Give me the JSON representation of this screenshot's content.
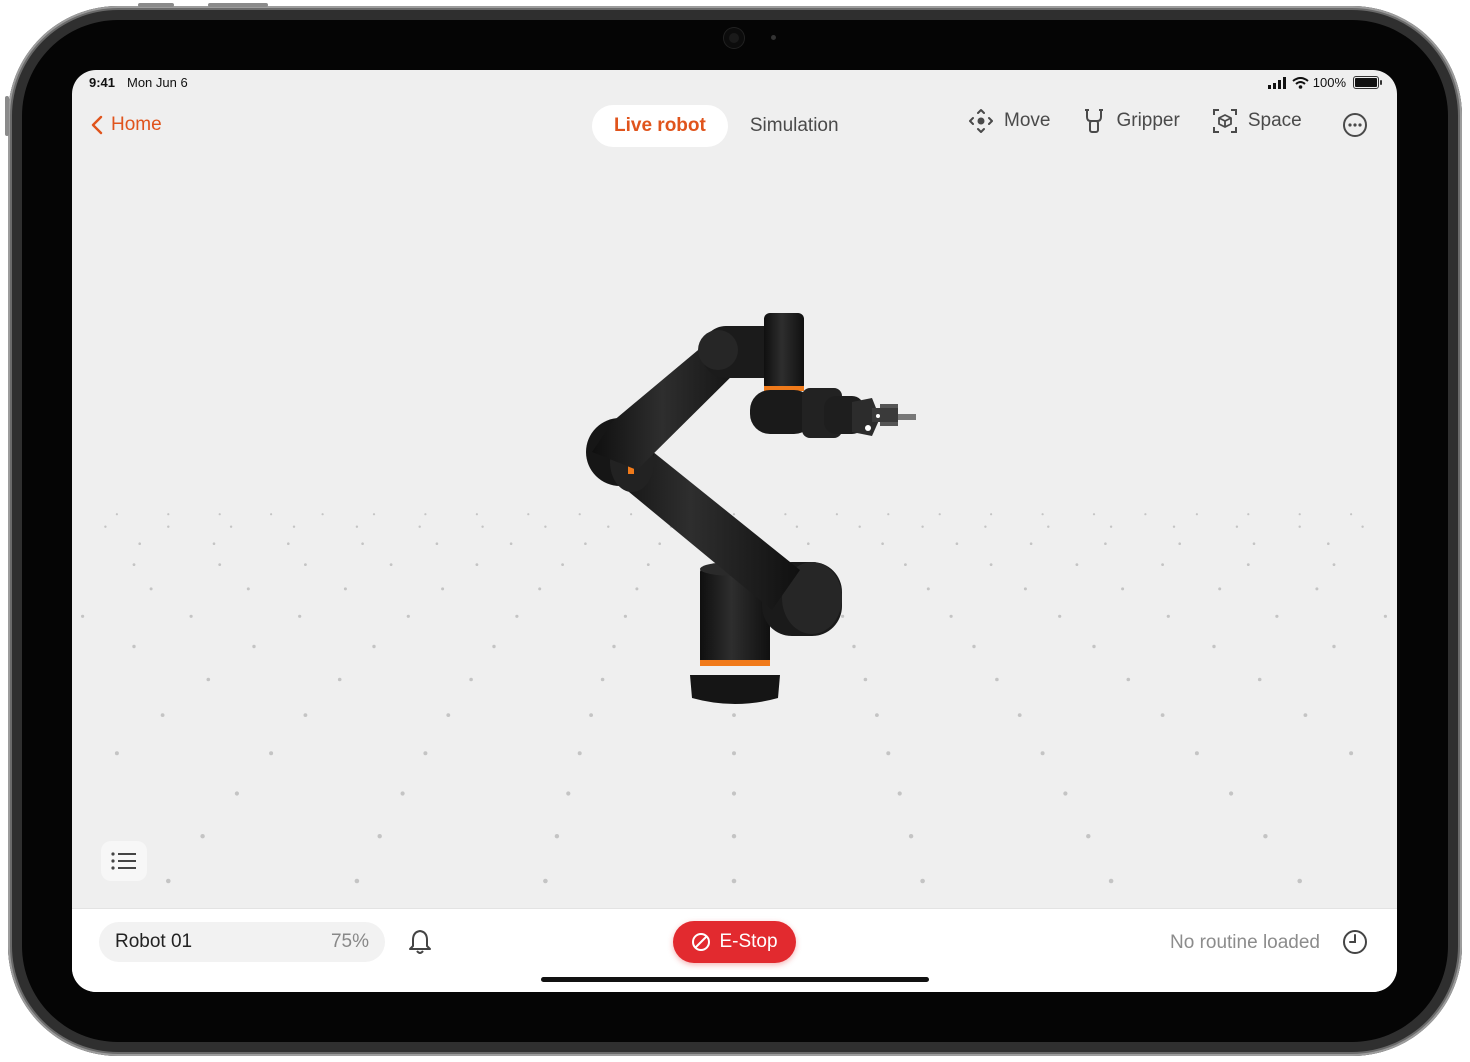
{
  "status_bar": {
    "time": "9:41",
    "date": "Mon Jun 6",
    "battery": "100%",
    "battery_level": 1.0
  },
  "nav": {
    "back_label": "Home"
  },
  "mode_tabs": [
    {
      "label": "Live robot",
      "active": true
    },
    {
      "label": "Simulation",
      "active": false
    }
  ],
  "toolbar": {
    "move_label": "Move",
    "gripper_label": "Gripper",
    "space_label": "Space"
  },
  "bottom_bar": {
    "robot_name": "Robot 01",
    "robot_percent": "75%",
    "estop_label": "E-Stop",
    "routine_status": "No routine loaded"
  },
  "colors": {
    "accent": "#e0541c",
    "estop": "#e22a2f",
    "background": "#efefef",
    "robot_body": "#1c1c1c",
    "joint_ring": "#f07a1a"
  },
  "icons": [
    "chevron-left-icon",
    "move-icon",
    "gripper-icon",
    "space-icon",
    "more-icon",
    "list-icon",
    "bell-icon",
    "stop-icon",
    "clock-icon"
  ]
}
